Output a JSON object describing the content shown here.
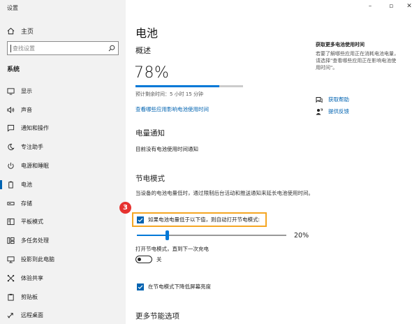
{
  "window": {
    "title": "设置",
    "minimize": "–",
    "maximize": "▫",
    "close": "✕"
  },
  "sidebar": {
    "home_label": "主页",
    "search_placeholder": "查找设置",
    "section_label": "系统",
    "items": [
      {
        "label": "显示",
        "icon": "monitor-icon"
      },
      {
        "label": "声音",
        "icon": "speaker-icon"
      },
      {
        "label": "通知和操作",
        "icon": "notification-icon"
      },
      {
        "label": "专注助手",
        "icon": "moon-icon"
      },
      {
        "label": "电源和睡眠",
        "icon": "power-icon"
      },
      {
        "label": "电池",
        "icon": "battery-icon",
        "active": true
      },
      {
        "label": "存储",
        "icon": "storage-icon"
      },
      {
        "label": "平板模式",
        "icon": "tablet-icon"
      },
      {
        "label": "多任务处理",
        "icon": "multitask-icon"
      },
      {
        "label": "投影到此电脑",
        "icon": "projector-icon"
      },
      {
        "label": "体验共享",
        "icon": "share-icon"
      },
      {
        "label": "剪贴板",
        "icon": "clipboard-icon"
      },
      {
        "label": "远程桌面",
        "icon": "remote-desktop-icon"
      }
    ]
  },
  "main": {
    "title": "电池",
    "overview_heading": "概述",
    "battery_percent": "78%",
    "battery_level": 0.78,
    "remaining_text": "预计剩余时间：5 小时 15 分钟",
    "see_apps_link": "查看哪些应用影响电池使用时间",
    "notify_heading": "电量通知",
    "notify_text": "目前没有电池使用时间通知",
    "saver_heading": "节电模式",
    "saver_desc": "当设备的电池电量低时，通过限制后台活动和推送通知来延长电池使用时间。",
    "step_badge": "3",
    "auto_on_label": "如果电池电量低于以下值，则自动打开节电模式:",
    "slider_value": "20%",
    "slider_level": 0.2,
    "until_charge_label": "打开节电模式，直到下一次充电",
    "toggle_state": "关",
    "lower_brightness_label": "在节电模式下降低屏幕亮度",
    "more_heading": "更多节能选项"
  },
  "right_panel": {
    "title": "获取更多电池使用时间",
    "desc": "若要了解哪些应用正在消耗电池电量，请选择\"查看哪些应用正在影响电池使用时间\"。",
    "help_link": "获取帮助",
    "feedback_link": "提供反馈"
  },
  "colors": {
    "accent": "#0078d7",
    "highlight": "#f5a623",
    "badge": "#e6322f"
  }
}
